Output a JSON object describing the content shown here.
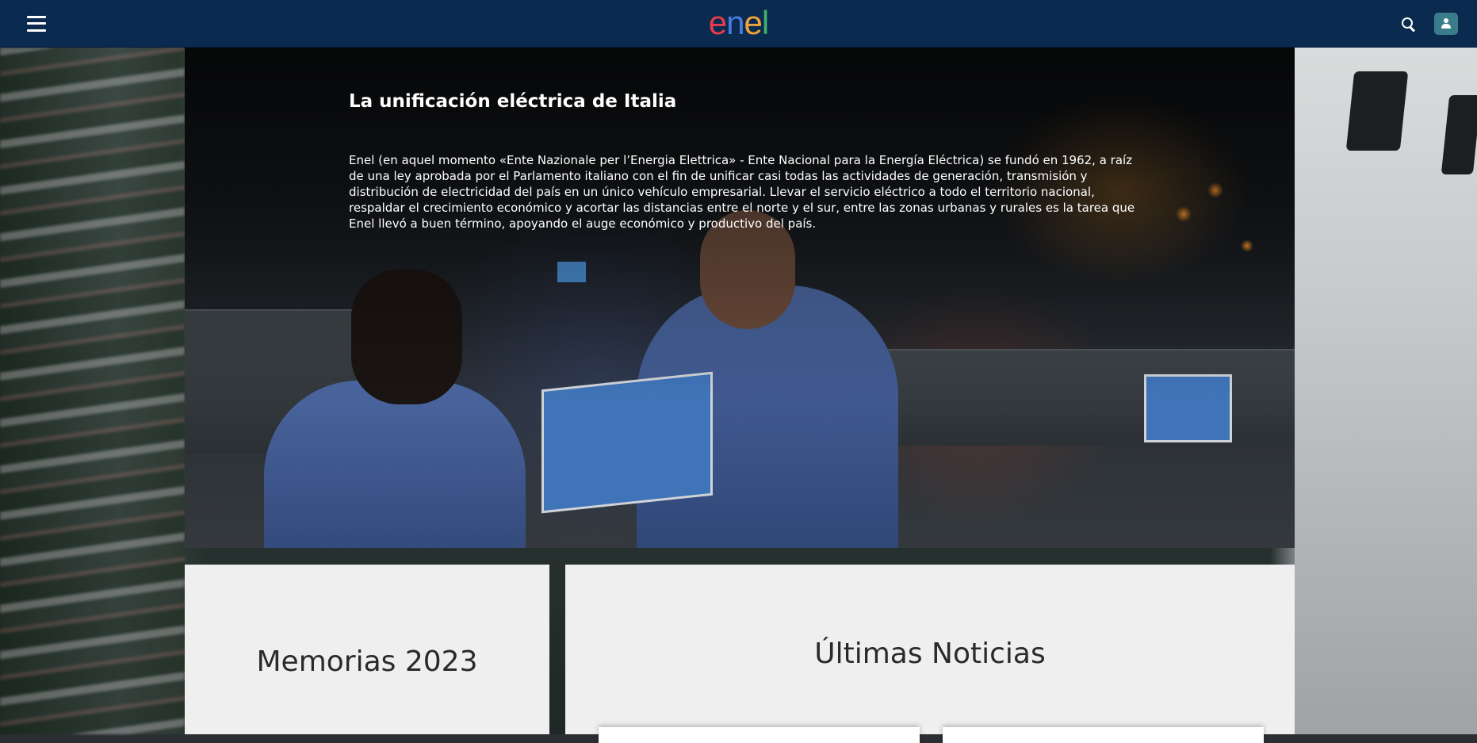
{
  "header": {
    "menu_icon": "hamburger-menu-icon",
    "logo_text": "enel",
    "logo_colors": [
      "#e83c4a",
      "#4a7be0",
      "#f2a33a",
      "#41b06c"
    ],
    "search_icon": "search-icon",
    "user_icon": "user-icon",
    "background_color": "#0a2a4f",
    "user_button_color": "#3a7c8a"
  },
  "hero": {
    "title": "La unificación eléctrica de Italia",
    "text": "Enel (en aquel momento «Ente Nazionale per l’Energia Elettrica» - Ente Nacional para la Energía Eléctrica) se fundó en 1962, a raíz de una ley aprobada por el Parlamento italiano con el fin de unificar casi todas las actividades de generación, transmisión y distribución de electricidad del país en un único vehículo empresarial. Llevar el servicio eléctrico a todo el territorio nacional, respaldar el crecimiento económico y acortar las distancias entre el norte y el sur, entre las zonas urbanas y rurales es la tarea que Enel llevó a buen término, apoyando el auge económico y productivo del país."
  },
  "cards": {
    "memorias_title": "Memorias 2023",
    "noticias_title": "Últimas Noticias"
  }
}
